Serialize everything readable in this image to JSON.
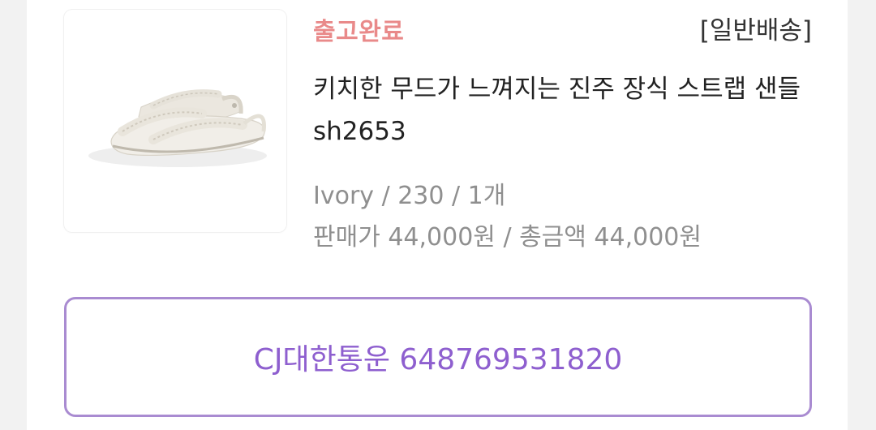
{
  "order": {
    "status": "출고완료",
    "shipping_type": "[일반배송]",
    "product_name": "키치한 무드가 느껴지는 진주 장식 스트랩 샌들 sh2653",
    "option": "Ivory / 230 / 1개",
    "price_line": "판매가 44,000원 / 총금액 44,000원",
    "image": "ivory-pearl-strap-sandals"
  },
  "tracking": {
    "label": "CJ대한통운 648769531820"
  },
  "colors": {
    "status": "#e98a8a",
    "accent": "#8e5fcf",
    "border": "#a98bd1"
  }
}
